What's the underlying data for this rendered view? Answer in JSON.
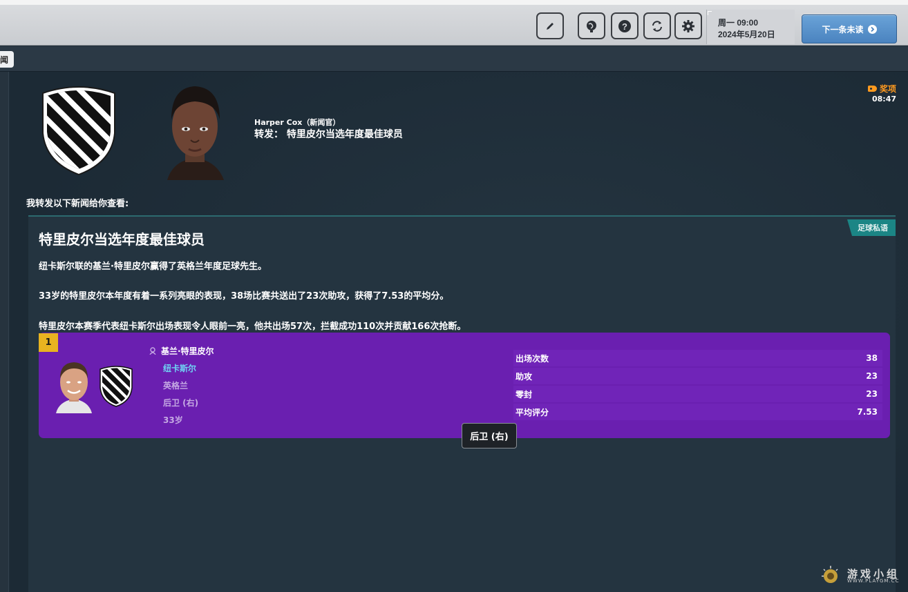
{
  "toolbar": {
    "date_line1": "周一 09:00",
    "date_line2": "2024年5月20日",
    "next_unread_label": "下一条未读",
    "icons": [
      "pencil-icon",
      "globe-icon",
      "help-icon",
      "refresh-icon",
      "gear-icon",
      "arrow-right-icon"
    ]
  },
  "tabs": {
    "active_tab_label": "闻"
  },
  "message": {
    "sender": "Harper Cox（新闻官）",
    "subject": "转发： 特里皮尔当选年度最佳球员",
    "awards_label": "奖项",
    "time": "08:47",
    "intro": "我转发以下新闻给你查看:"
  },
  "article": {
    "tag": "足球私语",
    "headline": "特里皮尔当选年度最佳球员",
    "paragraphs": [
      "纽卡斯尔联的基兰·特里皮尔赢得了英格兰年度足球先生。",
      "33岁的特里皮尔本年度有着一系列亮眼的表现，38场比赛共送出了23次助攻，获得了7.53的平均分。",
      "特里皮尔本赛季代表纽卡斯尔出场表现令人眼前一亮，他共出场57次，拦截成功110次并贡献166次抢断。"
    ]
  },
  "player_card": {
    "rank": "1",
    "name": "基兰·特里皮尔",
    "club": "纽卡斯尔",
    "nation": "英格兰",
    "position": "后卫 (右)",
    "age": "33岁",
    "stats": [
      {
        "label": "出场次数",
        "value": "38"
      },
      {
        "label": "助攻",
        "value": "23"
      },
      {
        "label": "零封",
        "value": "23"
      },
      {
        "label": "平均评分",
        "value": "7.53"
      }
    ],
    "card_color": "#6a1fb0",
    "rank_color": "#e8b320"
  },
  "tooltip": {
    "text": "后卫 (右)"
  },
  "watermark": {
    "text": "游戏小组",
    "url": "WWW.PLAYGM.CC"
  }
}
